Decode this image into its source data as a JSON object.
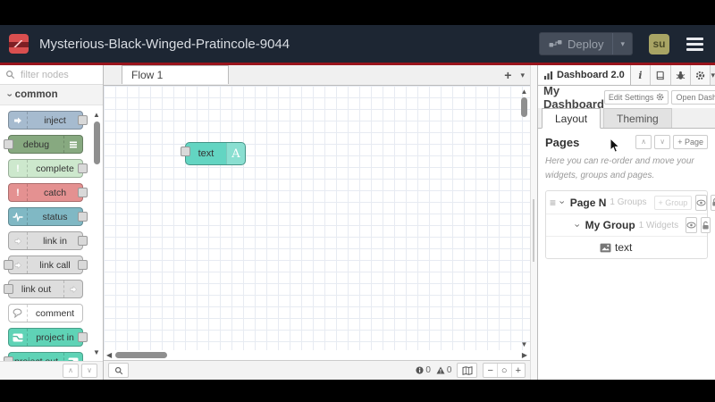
{
  "colors": {
    "header_bg": "#1d2633",
    "accent": "#99141c",
    "brand": "#d94f4f",
    "avatar_bg": "#a8a464",
    "canvas_node": "#63d5c2",
    "grid_line": "#e7ebf2"
  },
  "icons": {
    "caret_down": "▾",
    "plus": "+",
    "minus": "−",
    "circle_o": "○",
    "chevron": "›",
    "drag": "≡",
    "up_thin": "∧",
    "down_thin": "∨",
    "up_arrow": "▲",
    "down_arrow": "▼",
    "left_arrow": "◀",
    "right_arrow": "▶"
  },
  "header": {
    "title": "Mysterious-Black-Winged-Pratincole-9044",
    "deploy_label": "Deploy",
    "user_initials": "su"
  },
  "palette": {
    "search_placeholder": "filter nodes",
    "category": "common",
    "nodes": [
      {
        "label": "inject",
        "color": "#a6bbcf",
        "icon": "inject-arrow-icon",
        "icon_type": "arrow",
        "icon_side": "left",
        "ports": [
          "right"
        ]
      },
      {
        "label": "debug",
        "color": "#87a980",
        "icon": "debug-list-icon",
        "icon_type": "list",
        "icon_side": "right",
        "ports": [
          "left"
        ]
      },
      {
        "label": "complete",
        "color": "#cde8cd",
        "icon": "complete-exclamation-icon",
        "icon_type": "glyph",
        "glyph": "!",
        "icon_color": "#ffffff",
        "icon_side": "left",
        "ports": [
          "right"
        ]
      },
      {
        "label": "catch",
        "color": "#e49191",
        "icon": "catch-exclamation-icon",
        "icon_type": "glyph",
        "glyph": "!",
        "icon_color": "#ffffff",
        "icon_side": "left",
        "ports": [
          "right"
        ]
      },
      {
        "label": "status",
        "color": "#80b8c4",
        "icon": "status-pulse-icon",
        "icon_type": "pulse",
        "icon_side": "left",
        "ports": [
          "right"
        ]
      },
      {
        "label": "link in",
        "color": "#dddddd",
        "icon": "link-in-icon",
        "icon_type": "linkarrow",
        "icon_side": "left",
        "ports": [
          "right"
        ]
      },
      {
        "label": "link call",
        "color": "#dddddd",
        "icon": "link-call-icon",
        "icon_type": "linkarrow",
        "icon_side": "left",
        "ports": [
          "left",
          "right"
        ]
      },
      {
        "label": "link out",
        "color": "#dddddd",
        "icon": "link-out-icon",
        "icon_type": "linkarrow",
        "icon_side": "right",
        "ports": [
          "left"
        ]
      },
      {
        "label": "comment",
        "color": "#ffffff",
        "icon": "comment-bubble-icon",
        "icon_type": "bubble",
        "icon_side": "left",
        "ports": []
      },
      {
        "label": "project in",
        "color": "#5fd3b6",
        "icon": "project-logo-icon",
        "icon_type": "nrlogo",
        "icon_side": "left",
        "ports": [
          "right"
        ]
      },
      {
        "label": "project out",
        "color": "#5fd3b6",
        "icon": "project-logo-icon",
        "icon_type": "nrlogo",
        "icon_side": "right",
        "ports": [
          "left"
        ]
      }
    ]
  },
  "canvas": {
    "tab": "Flow 1",
    "node": {
      "label": "text",
      "icon_letter": "A"
    },
    "footer": {
      "info_count": "0",
      "warn_count": "0"
    }
  },
  "sidebar": {
    "tab_label": "Dashboard 2.0",
    "dashboard_title": "My Dashboard",
    "buttons": {
      "edit_settings": "Edit Settings",
      "open_dashboard": "Open Dashboard",
      "add_page": "+ Page",
      "add_group": "+ Group"
    },
    "tabs": [
      "Layout",
      "Theming"
    ],
    "pages_title": "Pages",
    "help_text": "Here you can re-order and move your widgets, groups and pages.",
    "tree": {
      "page": {
        "name": "Page N",
        "meta": "1 Groups"
      },
      "group": {
        "name": "My Group",
        "meta": "1 Widgets"
      },
      "widget": {
        "name": "text"
      }
    }
  }
}
